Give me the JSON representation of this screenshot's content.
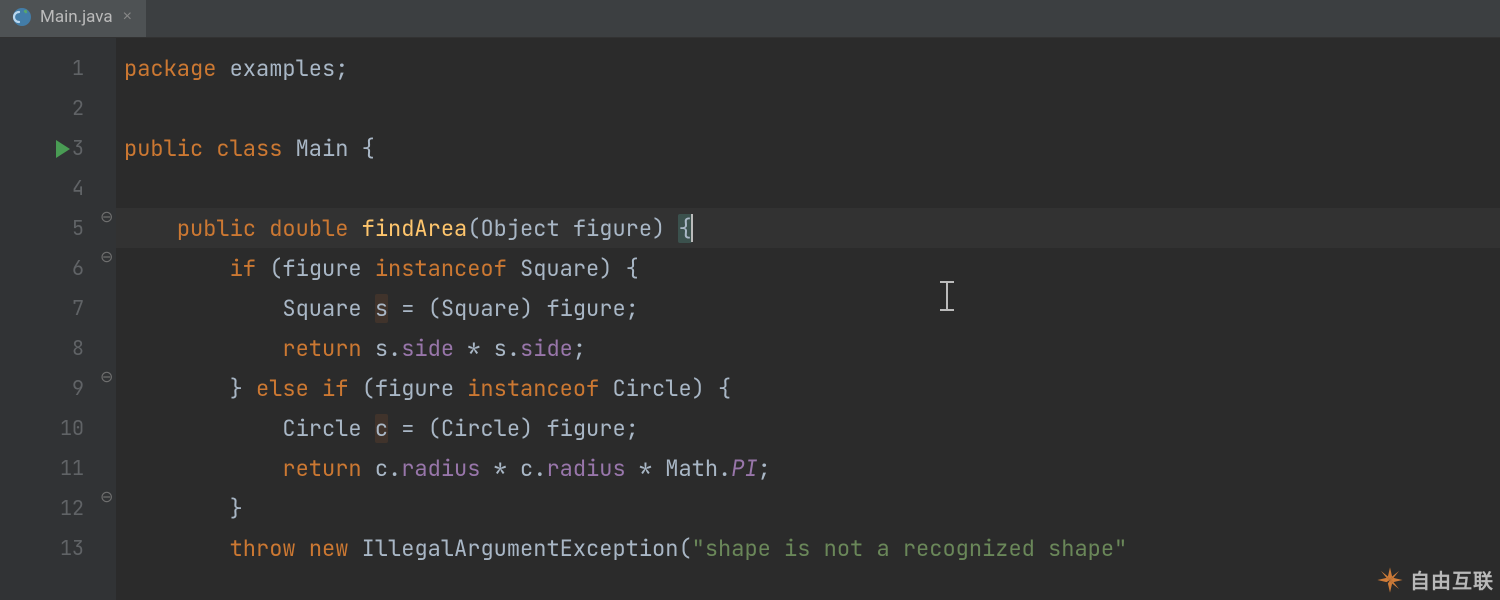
{
  "tab": {
    "filename": "Main.java",
    "icon": "java-class-icon",
    "close": "×"
  },
  "gutter": {
    "line_numbers": [
      "1",
      "2",
      "3",
      "4",
      "5",
      "6",
      "7",
      "8",
      "9",
      "10",
      "11",
      "12",
      "13"
    ],
    "run_line": 3
  },
  "editor": {
    "current_line": 5,
    "fold_marks": [
      {
        "line": 5,
        "glyph": "⊖"
      },
      {
        "line": 6,
        "glyph": "⊖"
      },
      {
        "line": 9,
        "glyph": "⊖"
      },
      {
        "line": 12,
        "glyph": "⊖"
      }
    ]
  },
  "code": {
    "l1": {
      "kw_package": "package",
      "pkg": " examples",
      "semi": ";"
    },
    "l3": {
      "kw_public": "public",
      "kw_class": " class",
      "typ": " Main",
      "brace": " {"
    },
    "l5": {
      "indent": "    ",
      "kw_public": "public",
      "kw_double": " double",
      "method": " findArea",
      "p1": "(",
      "typ": "Object",
      "sp": " ",
      "param": "figure",
      "p2": ")",
      "sp2": " ",
      "brace": "{"
    },
    "l6": {
      "indent": "        ",
      "kw_if": "if",
      "p1": " (",
      "id": "figure",
      "kw_inst": " instanceof ",
      "typ": "Square",
      "p2": ") ",
      "brace": "{"
    },
    "l7": {
      "indent": "            ",
      "typ": "Square ",
      "var": "s",
      "eq": " = (",
      "typ2": "Square",
      "p2": ") ",
      "id": "figure",
      "semi": ";"
    },
    "l8": {
      "indent": "            ",
      "kw": "return",
      "sp": " ",
      "a": "s.",
      "f1": "side",
      "op": " * ",
      "b": "s.",
      "f2": "side",
      "semi": ";"
    },
    "l9": {
      "indent": "        ",
      "brace": "}",
      "kw": " else if ",
      "p1": "(",
      "id": "figure",
      "kw_inst": " instanceof ",
      "typ": "Circle",
      "p2": ") ",
      "brace2": "{"
    },
    "l10": {
      "indent": "            ",
      "typ": "Circle ",
      "var": "c",
      "eq": " = (",
      "typ2": "Circle",
      "p2": ") ",
      "id": "figure",
      "semi": ";"
    },
    "l11": {
      "indent": "            ",
      "kw": "return",
      "sp": " ",
      "a": "c.",
      "f1": "radius",
      "op": " * ",
      "b": "c.",
      "f2": "radius",
      "op2": " * ",
      "cls": "Math.",
      "pi": "PI",
      "semi": ";"
    },
    "l12": {
      "indent": "        ",
      "brace": "}"
    },
    "l13": {
      "indent": "        ",
      "kw_throw": "throw",
      "kw_new": " new ",
      "typ": "IllegalArgumentException",
      "p1": "(",
      "str": "\"shape is not a recognized shape\""
    }
  },
  "watermark": {
    "text": "自由互联"
  }
}
